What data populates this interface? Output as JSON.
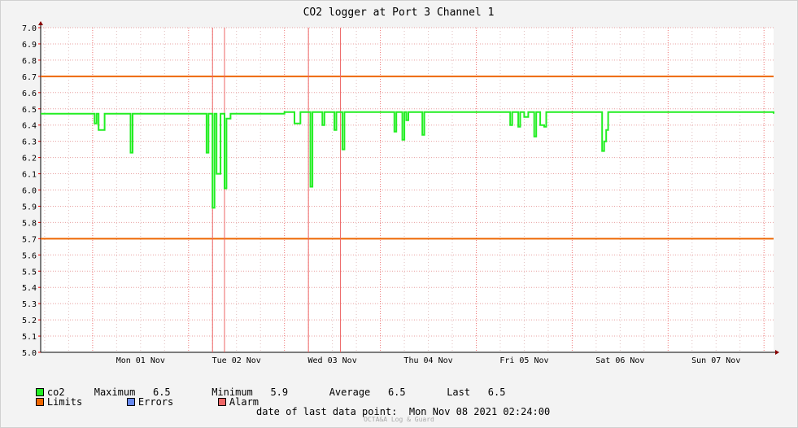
{
  "chart_data": {
    "type": "line",
    "title": "CO2 logger at Port 3 Channel 1",
    "ylim": [
      5.0,
      7.0
    ],
    "xlim": [
      "2021-10-31 11:00",
      "2021-11-08 02:24"
    ],
    "y_ticks": [
      "5.0",
      "5.1",
      "5.2",
      "5.3",
      "5.4",
      "5.5",
      "5.6",
      "5.7",
      "5.8",
      "5.9",
      "6.0",
      "6.1",
      "6.2",
      "6.3",
      "6.4",
      "6.5",
      "6.6",
      "6.7",
      "6.8",
      "6.9",
      "7.0"
    ],
    "x_tick_labels": [
      {
        "label": "Mon 01 Nov",
        "at": "2021-11-01 12:00"
      },
      {
        "label": "Tue 02 Nov",
        "at": "2021-11-02 12:00"
      },
      {
        "label": "Wed 03 Nov",
        "at": "2021-11-03 12:00"
      },
      {
        "label": "Thu 04 Nov",
        "at": "2021-11-04 12:00"
      },
      {
        "label": "Fri 05 Nov",
        "at": "2021-11-05 12:00"
      },
      {
        "label": "Sat 06 Nov",
        "at": "2021-11-06 12:00"
      },
      {
        "label": "Sun 07 Nov",
        "at": "2021-11-07 12:00"
      }
    ],
    "grid": true,
    "limits": [
      5.7,
      6.7
    ],
    "alarms": [
      "2021-11-02 06:00",
      "2021-11-02 09:00",
      "2021-11-03 06:00",
      "2021-11-03 14:00"
    ],
    "series": [
      {
        "name": "co2",
        "color": "#22ee22",
        "baseline": 6.48,
        "points": [
          [
            "2021-10-31 11:00",
            6.47
          ],
          [
            "2021-11-01 00:00",
            6.47
          ],
          [
            "2021-11-01 00:30",
            6.41
          ],
          [
            "2021-11-01 01:00",
            6.47
          ],
          [
            "2021-11-01 01:30",
            6.37
          ],
          [
            "2021-11-01 02:30",
            6.37
          ],
          [
            "2021-11-01 03:00",
            6.47
          ],
          [
            "2021-11-01 09:00",
            6.47
          ],
          [
            "2021-11-01 09:30",
            6.23
          ],
          [
            "2021-11-01 10:00",
            6.47
          ],
          [
            "2021-11-02 00:00",
            6.47
          ],
          [
            "2021-11-02 04:00",
            6.47
          ],
          [
            "2021-11-02 04:30",
            6.23
          ],
          [
            "2021-11-02 05:00",
            6.47
          ],
          [
            "2021-11-02 06:00",
            5.89
          ],
          [
            "2021-11-02 06:30",
            6.47
          ],
          [
            "2021-11-02 07:00",
            6.1
          ],
          [
            "2021-11-02 08:00",
            6.47
          ],
          [
            "2021-11-02 09:00",
            6.01
          ],
          [
            "2021-11-02 09:30",
            6.44
          ],
          [
            "2021-11-02 10:30",
            6.47
          ],
          [
            "2021-11-03 00:00",
            6.48
          ],
          [
            "2021-11-03 02:00",
            6.48
          ],
          [
            "2021-11-03 02:30",
            6.41
          ],
          [
            "2021-11-03 03:30",
            6.41
          ],
          [
            "2021-11-03 04:00",
            6.48
          ],
          [
            "2021-11-03 06:00",
            6.48
          ],
          [
            "2021-11-03 06:30",
            6.02
          ],
          [
            "2021-11-03 07:00",
            6.48
          ],
          [
            "2021-11-03 09:00",
            6.48
          ],
          [
            "2021-11-03 09:30",
            6.4
          ],
          [
            "2021-11-03 10:00",
            6.48
          ],
          [
            "2021-11-03 12:00",
            6.48
          ],
          [
            "2021-11-03 12:30",
            6.37
          ],
          [
            "2021-11-03 13:00",
            6.48
          ],
          [
            "2021-11-03 14:00",
            6.48
          ],
          [
            "2021-11-03 14:30",
            6.25
          ],
          [
            "2021-11-03 15:00",
            6.48
          ],
          [
            "2021-11-04 00:00",
            6.48
          ],
          [
            "2021-11-04 03:00",
            6.48
          ],
          [
            "2021-11-04 03:30",
            6.36
          ],
          [
            "2021-11-04 04:00",
            6.48
          ],
          [
            "2021-11-04 05:00",
            6.48
          ],
          [
            "2021-11-04 05:30",
            6.31
          ],
          [
            "2021-11-04 06:00",
            6.48
          ],
          [
            "2021-11-04 06:30",
            6.43
          ],
          [
            "2021-11-04 07:00",
            6.48
          ],
          [
            "2021-11-04 10:00",
            6.48
          ],
          [
            "2021-11-04 10:30",
            6.34
          ],
          [
            "2021-11-04 11:00",
            6.48
          ],
          [
            "2021-11-05 00:00",
            6.48
          ],
          [
            "2021-11-05 08:00",
            6.48
          ],
          [
            "2021-11-05 08:30",
            6.4
          ],
          [
            "2021-11-05 09:00",
            6.48
          ],
          [
            "2021-11-05 10:00",
            6.48
          ],
          [
            "2021-11-05 10:30",
            6.39
          ],
          [
            "2021-11-05 11:00",
            6.48
          ],
          [
            "2021-11-05 12:00",
            6.45
          ],
          [
            "2021-11-05 13:00",
            6.48
          ],
          [
            "2021-11-05 14:00",
            6.48
          ],
          [
            "2021-11-05 14:30",
            6.33
          ],
          [
            "2021-11-05 15:00",
            6.48
          ],
          [
            "2021-11-05 16:00",
            6.4
          ],
          [
            "2021-11-05 17:00",
            6.39
          ],
          [
            "2021-11-05 17:30",
            6.48
          ],
          [
            "2021-11-06 00:00",
            6.48
          ],
          [
            "2021-11-06 07:00",
            6.48
          ],
          [
            "2021-11-06 07:30",
            6.24
          ],
          [
            "2021-11-06 08:00",
            6.3
          ],
          [
            "2021-11-06 08:30",
            6.37
          ],
          [
            "2021-11-06 09:00",
            6.48
          ],
          [
            "2021-11-07 00:00",
            6.48
          ],
          [
            "2021-11-08 02:24",
            6.47
          ]
        ]
      }
    ]
  },
  "legend": {
    "co2_label": "co2",
    "stats": "Maximum   6.5       Minimum   5.9       Average   6.5       Last   6.5",
    "limits_label": "Limits",
    "errors_label": "Errors",
    "alarm_label": "Alarm",
    "colors": {
      "co2": "#22ee22",
      "limits": "#ee6600",
      "errors": "#6688ee",
      "alarm": "#ee6666"
    }
  },
  "footer": {
    "last_point": "date of last data point:  Mon Nov 08 2021 02:24:00",
    "credit": "OCTA&A Log & Guard"
  }
}
